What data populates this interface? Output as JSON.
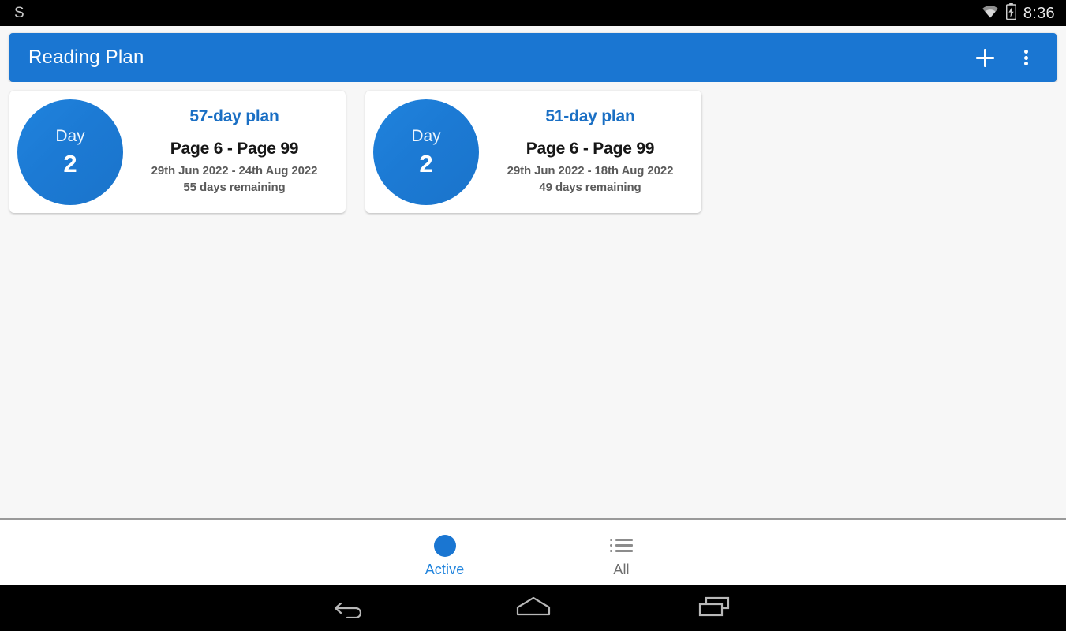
{
  "status_bar": {
    "left_letter": "S",
    "wifi_icon": "wifi-icon",
    "battery_icon": "battery-charging-icon",
    "time": "8:36"
  },
  "app_bar": {
    "title": "Reading Plan",
    "add_icon": "plus-icon",
    "overflow_icon": "more-vertical-icon",
    "color": "#1a76d2"
  },
  "plans": [
    {
      "day_label": "Day",
      "day_number": "2",
      "title": "57-day plan",
      "pages": "Page 6 - Page 99",
      "dates": "29th Jun 2022 - 24th Aug 2022",
      "remaining": "55 days remaining"
    },
    {
      "day_label": "Day",
      "day_number": "2",
      "title": "51-day plan",
      "pages": "Page 6 - Page 99",
      "dates": "29th Jun 2022 - 18th Aug 2022",
      "remaining": "49 days remaining"
    }
  ],
  "bottom_nav": {
    "items": [
      {
        "label": "Active",
        "icon": "filled-circle-icon",
        "selected": true,
        "color": "#2184dd"
      },
      {
        "label": "All",
        "icon": "list-icon",
        "selected": false,
        "color": "#6d6d6d"
      }
    ]
  },
  "system_nav": {
    "back_icon": "back-arrow-icon",
    "home_icon": "home-icon",
    "recents_icon": "recents-icon"
  }
}
